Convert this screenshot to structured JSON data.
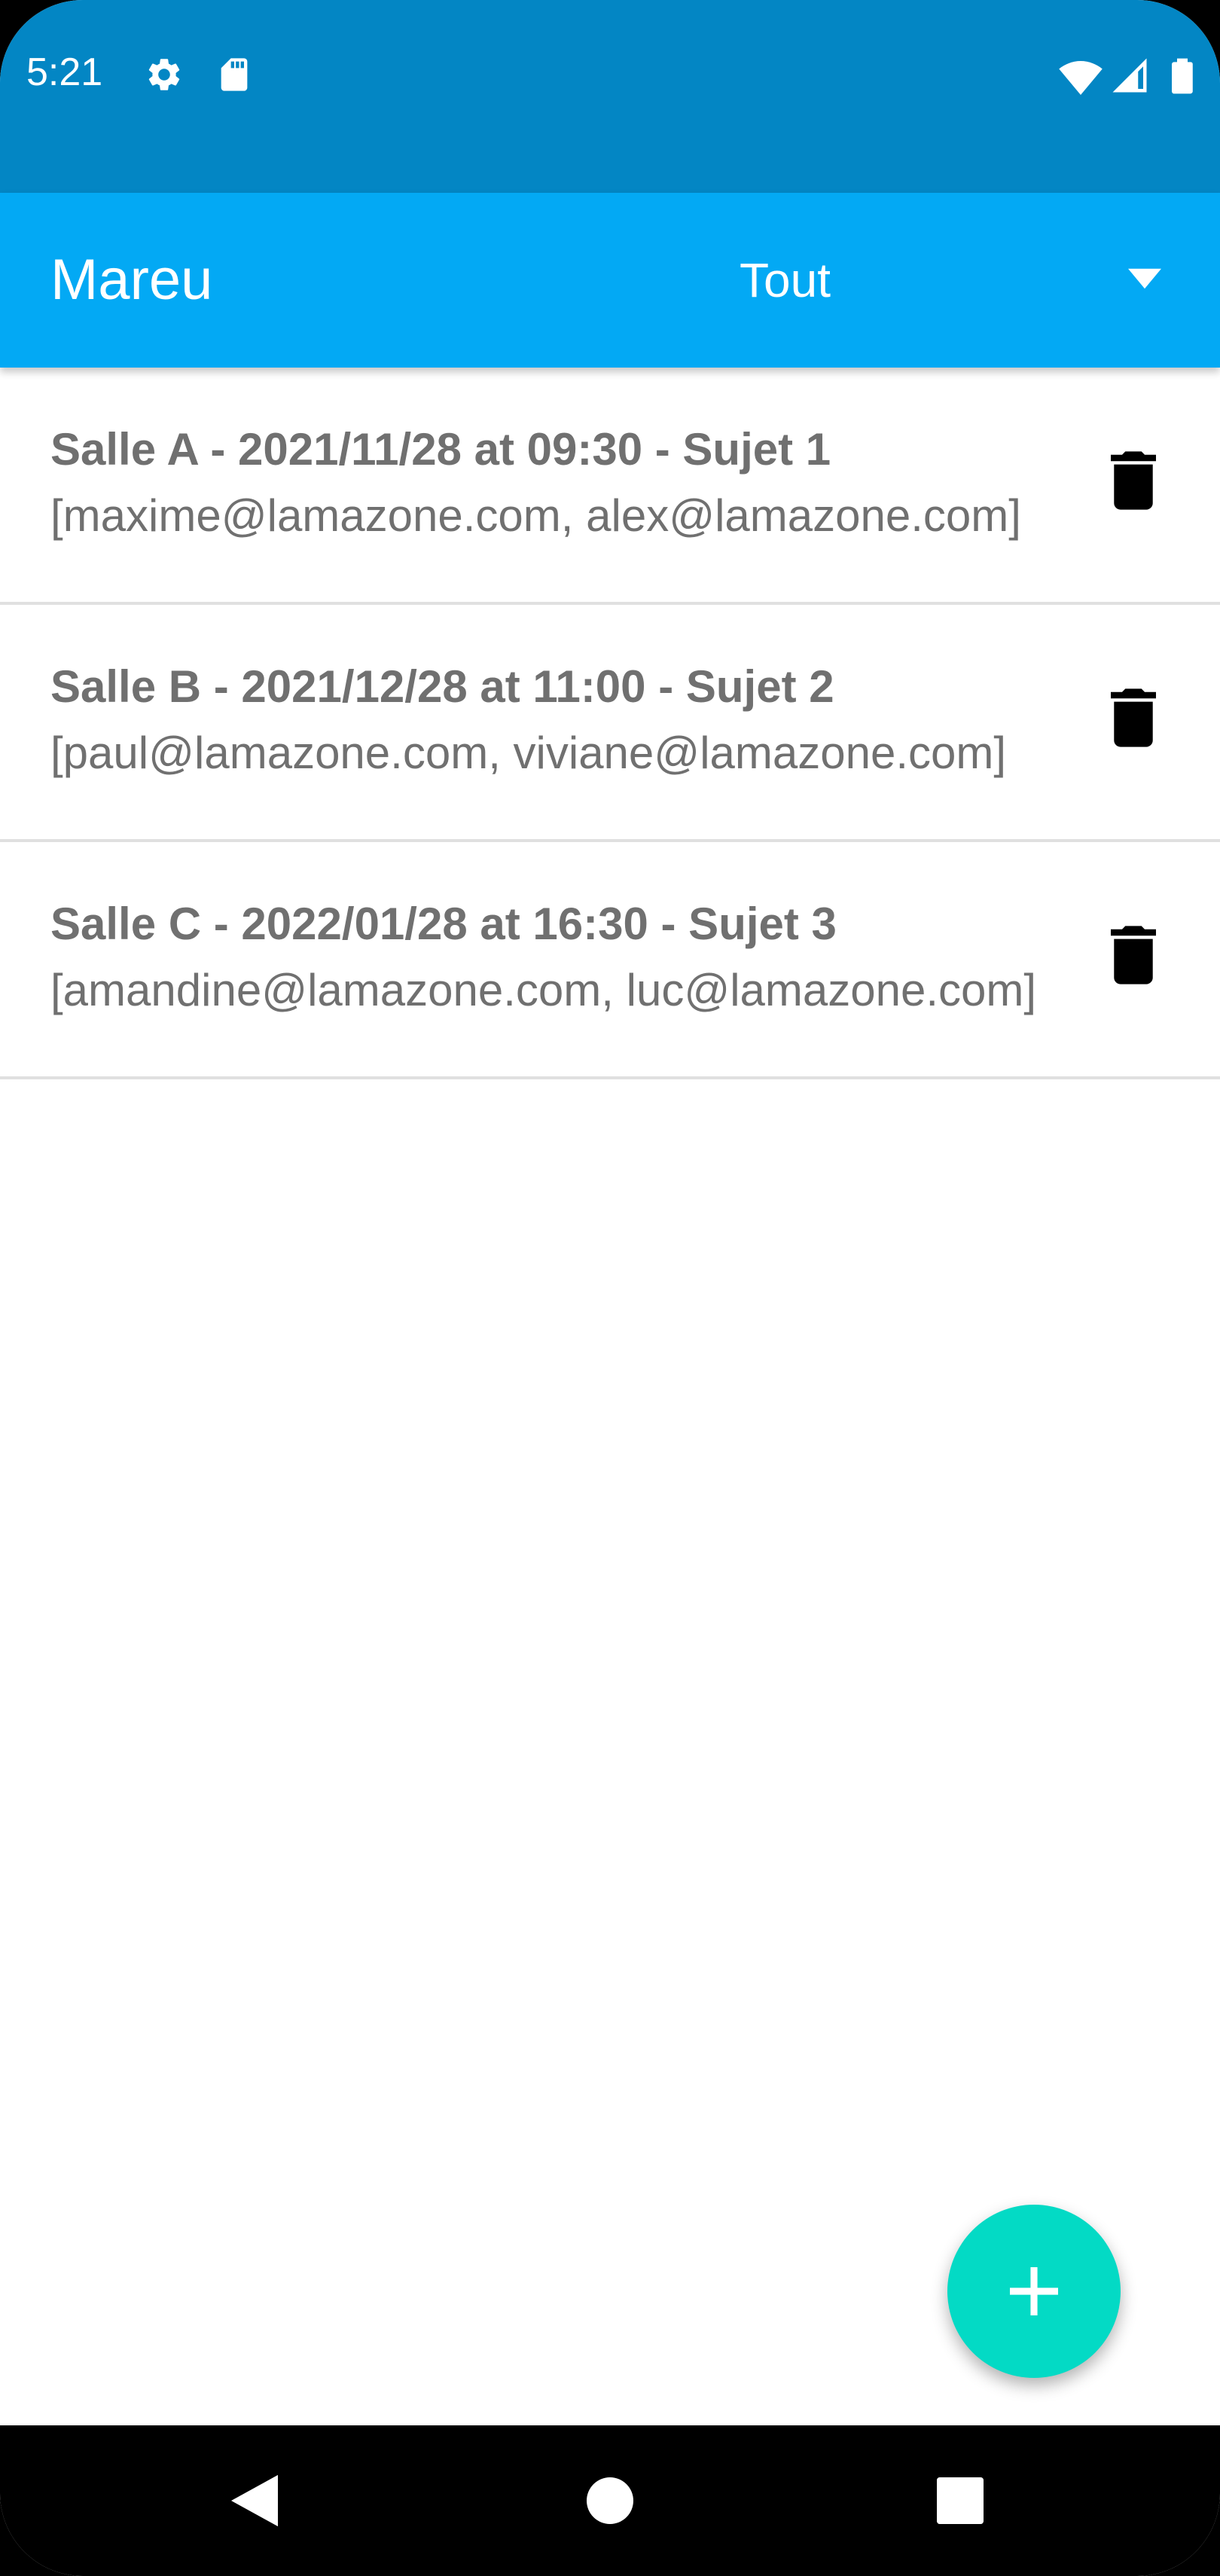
{
  "status_bar": {
    "time": "5:21",
    "left_icons": [
      "settings-icon",
      "sd-card-icon"
    ],
    "right_icons": [
      "wifi-icon",
      "signal-icon",
      "battery-icon"
    ]
  },
  "app_bar": {
    "title": "Mareu",
    "filter": {
      "selected": "Tout"
    }
  },
  "meetings": [
    {
      "title": "Salle A - 2021/11/28 at 09:30 - Sujet 1",
      "participants": "[maxime@lamazone.com, alex@lamazone.com]"
    },
    {
      "title": "Salle B - 2021/12/28 at 11:00 - Sujet 2",
      "participants": "[paul@lamazone.com, viviane@lamazone.com]"
    },
    {
      "title": "Salle C - 2022/01/28 at 16:30 - Sujet 3",
      "participants": "[amandine@lamazone.com, luc@lamazone.com]"
    }
  ],
  "fab": {
    "icon": "plus-icon"
  },
  "nav_bar": {
    "buttons": [
      "back-icon",
      "home-icon",
      "recents-icon"
    ]
  },
  "colors": {
    "status_bar": "#0386c4",
    "app_bar": "#03a9f4",
    "fab": "#03dac5",
    "list_text": "#707070",
    "divider": "#e0e0e0"
  }
}
